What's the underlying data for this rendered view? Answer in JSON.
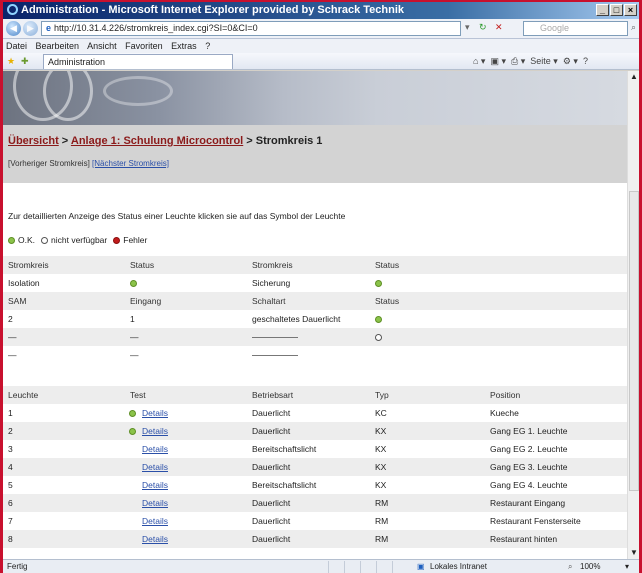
{
  "window": {
    "title": "Administration - Microsoft Internet Explorer provided by Schrack Technik",
    "buttons": [
      "_",
      "□",
      "×"
    ]
  },
  "address": {
    "url": "http://10.31.4.226/stromkreis_index.cgi?SI=0&CI=0",
    "search_placeholder": "Google"
  },
  "menu": [
    "Datei",
    "Bearbeiten",
    "Ansicht",
    "Favoriten",
    "Extras",
    "?"
  ],
  "tab": {
    "label": "Administration"
  },
  "toolbar_right": "Seite ▾",
  "breadcrumb": {
    "link1": "Übersicht",
    "sep1": " > ",
    "link2": "Anlage 1: Schulung Microcontrol",
    "sep2": " > ",
    "current": "Stromkreis 1"
  },
  "prevnext": {
    "prev": "[Vorheriger Stromkreis]",
    "next": "[Nächster Stromkreis]"
  },
  "hint": "Zur detaillierten Anzeige des Status einer Leuchte klicken sie auf das Symbol der Leuchte",
  "legend": {
    "ok": "O.K.",
    "na": "nicht verfügbar",
    "err": "Fehler"
  },
  "circuit_table": {
    "headers": [
      "Stromkreis",
      "Status",
      "Stromkreis",
      "Status"
    ],
    "row1": [
      "Isolation",
      "ok",
      "Sicherung",
      "ok"
    ],
    "headers2": [
      "SAM",
      "Eingang",
      "Schaltart",
      "Status"
    ],
    "row2": [
      "2",
      "1",
      "geschaltetes Dauerlicht",
      "ok"
    ],
    "dash": "—"
  },
  "lamp_table": {
    "headers": [
      "Leuchte",
      "Test",
      "Betriebsart",
      "Typ",
      "Position"
    ],
    "details_label": "Details",
    "rows": [
      {
        "nr": "1",
        "status": "ok",
        "mode": "Dauerlicht",
        "typ": "KC",
        "pos": "Kueche"
      },
      {
        "nr": "2",
        "status": "ok",
        "mode": "Dauerlicht",
        "typ": "KX",
        "pos": "Gang EG 1. Leuchte"
      },
      {
        "nr": "3",
        "status": "",
        "mode": "Bereitschaftslicht",
        "typ": "KX",
        "pos": "Gang EG 2. Leuchte"
      },
      {
        "nr": "4",
        "status": "",
        "mode": "Dauerlicht",
        "typ": "KX",
        "pos": "Gang EG 3. Leuchte"
      },
      {
        "nr": "5",
        "status": "",
        "mode": "Bereitschaftslicht",
        "typ": "KX",
        "pos": "Gang EG 4. Leuchte"
      },
      {
        "nr": "6",
        "status": "",
        "mode": "Dauerlicht",
        "typ": "RM",
        "pos": "Restaurant Eingang"
      },
      {
        "nr": "7",
        "status": "",
        "mode": "Dauerlicht",
        "typ": "RM",
        "pos": "Restaurant Fensterseite"
      },
      {
        "nr": "8",
        "status": "",
        "mode": "Dauerlicht",
        "typ": "RM",
        "pos": "Restaurant hinten"
      }
    ]
  },
  "status": {
    "left": "Fertig",
    "zone": "Lokales Intranet",
    "zoom": "100%"
  }
}
